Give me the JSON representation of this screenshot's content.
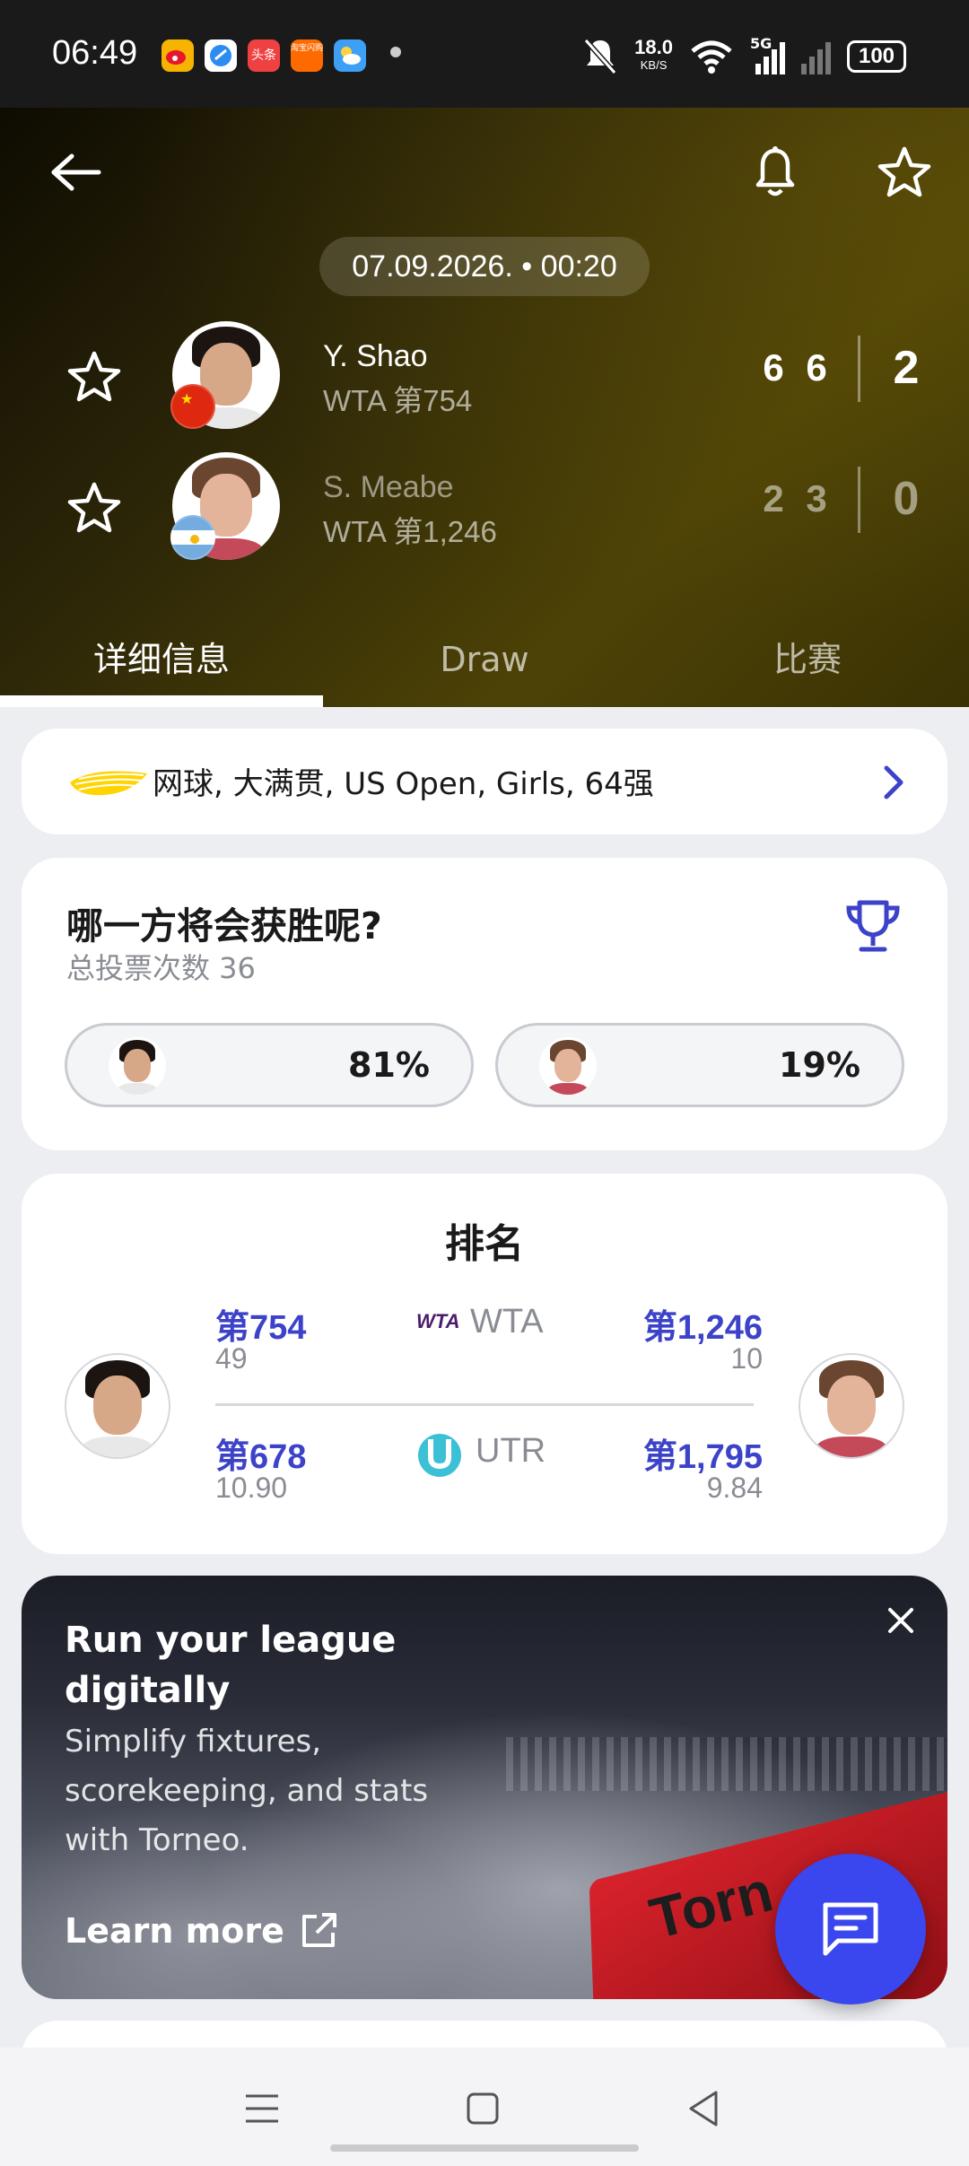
{
  "status_bar": {
    "time": "06:49",
    "net_speed": "18.0",
    "net_unit": "KB/S",
    "net_type": "5G",
    "battery": "100",
    "notif_apps": [
      "weibo-icon",
      "browser-icon",
      "toutiao-icon",
      "taobao-icon",
      "weather-icon"
    ],
    "notif_labels": [
      "",
      "",
      "头条",
      "淘宝闪购",
      ""
    ]
  },
  "match": {
    "datetime": "07.09.2026. • 00:20",
    "players": [
      {
        "name": "Y. Shao",
        "rank": "WTA 第754",
        "sets": [
          "6",
          "6"
        ],
        "total": "2",
        "flag": "china"
      },
      {
        "name": "S. Meabe",
        "rank": "WTA 第1,246",
        "sets": [
          "2",
          "3"
        ],
        "total": "0",
        "flag": "argentina"
      }
    ]
  },
  "tabs": [
    {
      "label": "详细信息",
      "active": true
    },
    {
      "label": "Draw",
      "active": false
    },
    {
      "label": "比赛",
      "active": false
    }
  ],
  "breadcrumb": {
    "text": "网球, 大满贯, US Open, Girls, 64强"
  },
  "vote": {
    "question": "哪一方将会获胜呢?",
    "total_label": "总投票次数 36",
    "options": [
      {
        "percent": "81%",
        "value": 81
      },
      {
        "percent": "19%",
        "value": 19
      }
    ]
  },
  "ranking": {
    "title": "排名",
    "rows": [
      {
        "org": "WTA",
        "org_logo": "WTA",
        "left_rank": "第754",
        "left_points": "49",
        "right_rank": "第1,246",
        "right_points": "10"
      },
      {
        "org": "UTR",
        "left_rank": "第678",
        "left_points": "10.90",
        "right_rank": "第1,795",
        "right_points": "9.84"
      }
    ]
  },
  "ad": {
    "headline": "Run your league digitally",
    "body": "Simplify fixtures, scorekeeping, and stats with Torneo.",
    "cta": "Learn more",
    "flag_text": "Torn"
  },
  "colors": {
    "accent_blue": "#3c43c9",
    "fab_blue": "#3a46ee",
    "header_gold": "#4d4206"
  }
}
